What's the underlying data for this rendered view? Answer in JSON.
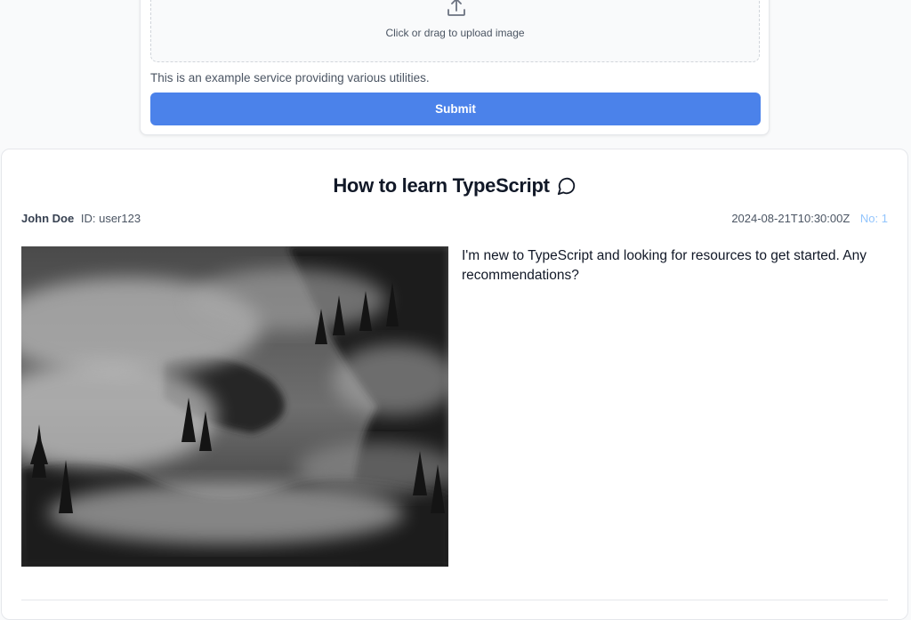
{
  "upload": {
    "icon": "upload-icon",
    "text": "Click or drag to upload image"
  },
  "service": {
    "description": "This is an example service providing various utilities."
  },
  "form": {
    "submit_label": "Submit"
  },
  "post": {
    "title": "How to learn TypeScript",
    "comment_icon": "comment-icon",
    "author_name": "John Doe",
    "author_id": "ID: user123",
    "timestamp": "2024-08-21T10:30:00Z",
    "number": "No: 1",
    "body": "I'm new to TypeScript and looking for resources to get started. Any recommendations?",
    "image_description": "foggy-forest-photo"
  },
  "colors": {
    "accent": "#4b82ea",
    "post_number": "#93c5fd"
  }
}
